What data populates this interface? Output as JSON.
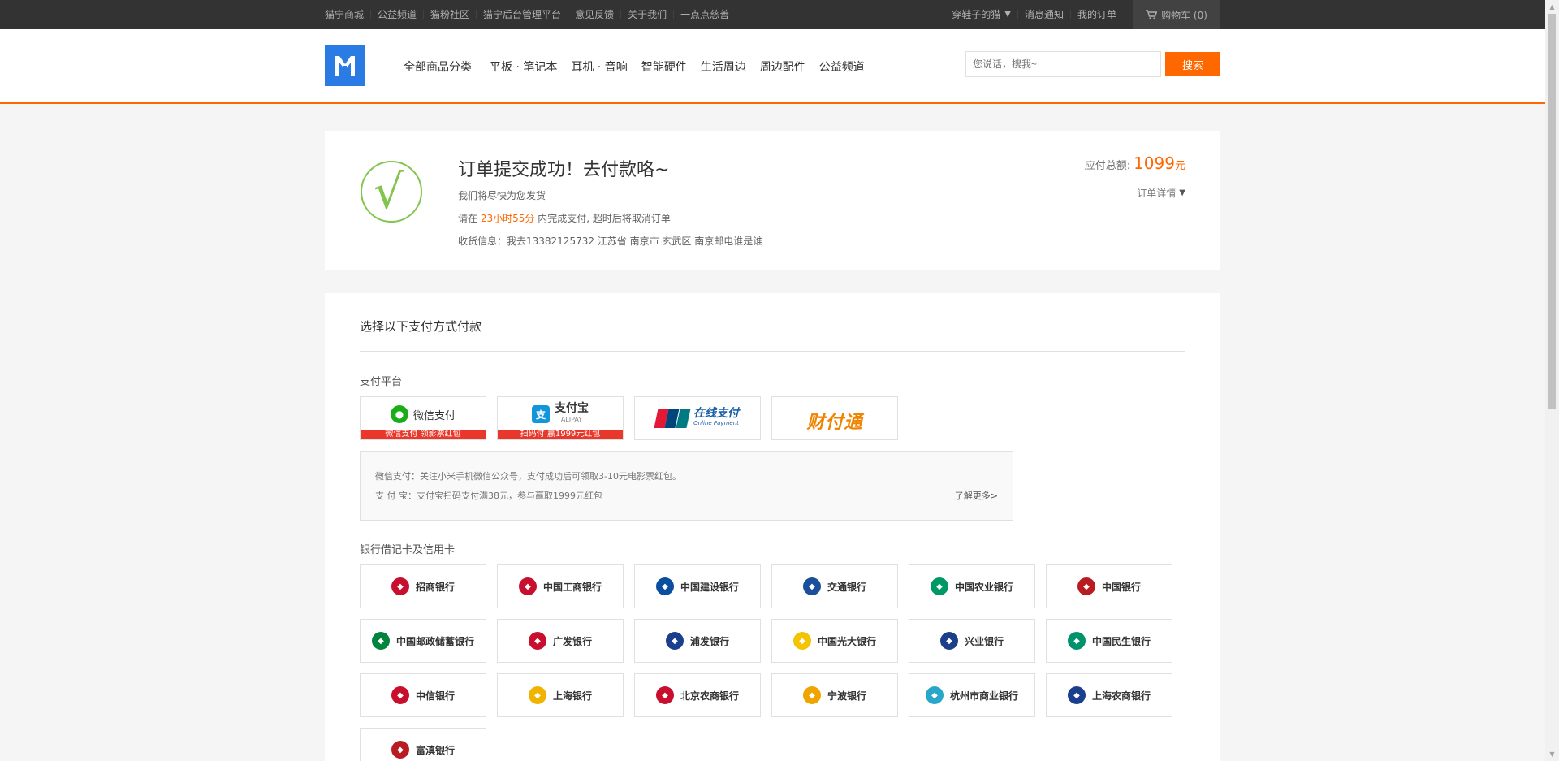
{
  "topbar": {
    "links": [
      "猫宁商城",
      "公益频道",
      "猫粉社区",
      "猫宁后台管理平台",
      "意见反馈",
      "关于我们",
      "一点点慈善"
    ],
    "user": "穿鞋子的猫",
    "notify": "消息通知",
    "orders": "我的订单",
    "cart": "购物车 (0)"
  },
  "header": {
    "logo_text": "M",
    "nav": [
      "全部商品分类",
      "平板 · 笔记本",
      "耳机 · 音响",
      "智能硬件",
      "生活周边",
      "周边配件",
      "公益频道"
    ],
    "search_placeholder": "您说话，搜我~",
    "search_button": "搜索"
  },
  "order": {
    "check_glyph": "√",
    "title": "订单提交成功！去付款咯~",
    "line1": "我们将尽快为您发货",
    "line2_pre": "请在 ",
    "line2_time": "23小时55分",
    "line2_post": " 内完成支付, 超时后将取消订单",
    "line3": "收货信息：我去13382125732  江苏省  南京市  玄武区  南京邮电谁是谁",
    "total_label": "应付总额:",
    "total_amount": "1099",
    "total_unit": "元",
    "detail_link": "订单详情"
  },
  "payment": {
    "heading": "选择以下支付方式付款",
    "platform_label": "支付平台",
    "platforms": [
      {
        "name": "微信支付",
        "badge": "微信支付 领影票红包",
        "color": "#1aad19",
        "icon": "wechat-icon"
      },
      {
        "name": "支付宝",
        "sub": "ALIPAY",
        "badge": "扫码付 赢1999元红包",
        "color": "#1296db",
        "icon": "alipay-icon"
      },
      {
        "name": "在线支付",
        "sub": "Online Payment",
        "badge": "",
        "color": "#1a5fa8",
        "icon": "unionpay-icon"
      },
      {
        "name": "财付通",
        "badge": "",
        "color": "#f08300",
        "icon": "tenpay-icon"
      }
    ],
    "info_line1": "微信支付：关注小米手机微信公众号，支付成功后可领取3-10元电影票红包。",
    "info_line2": "支 付 宝：支付宝扫码支付满38元，参与赢取1999元红包",
    "info_more": "了解更多>",
    "bank_label": "银行借记卡及信用卡",
    "banks": [
      {
        "name": "招商银行",
        "color": "#c8102e"
      },
      {
        "name": "中国工商银行",
        "color": "#c8102e"
      },
      {
        "name": "中国建设银行",
        "color": "#0a4ea1"
      },
      {
        "name": "交通银行",
        "color": "#1b4e9b"
      },
      {
        "name": "中国农业银行",
        "color": "#009966"
      },
      {
        "name": "中国银行",
        "color": "#b81c22"
      },
      {
        "name": "中国邮政储蓄银行",
        "color": "#00843d"
      },
      {
        "name": "广发银行",
        "color": "#c8102e"
      },
      {
        "name": "浦发银行",
        "color": "#1b3f8f"
      },
      {
        "name": "中国光大银行",
        "color": "#f5c400"
      },
      {
        "name": "兴业银行",
        "color": "#1d3f8a"
      },
      {
        "name": "中国民生银行",
        "color": "#00936b"
      },
      {
        "name": "中信银行",
        "color": "#c8102e"
      },
      {
        "name": "上海银行",
        "color": "#f0b400"
      },
      {
        "name": "北京农商银行",
        "color": "#c8102e"
      },
      {
        "name": "宁波银行",
        "color": "#f0a400"
      },
      {
        "name": "杭州市商业银行",
        "color": "#2aa6c8"
      },
      {
        "name": "上海农商银行",
        "color": "#1b3f8f"
      },
      {
        "name": "富滇银行",
        "color": "#b81c22"
      }
    ]
  }
}
